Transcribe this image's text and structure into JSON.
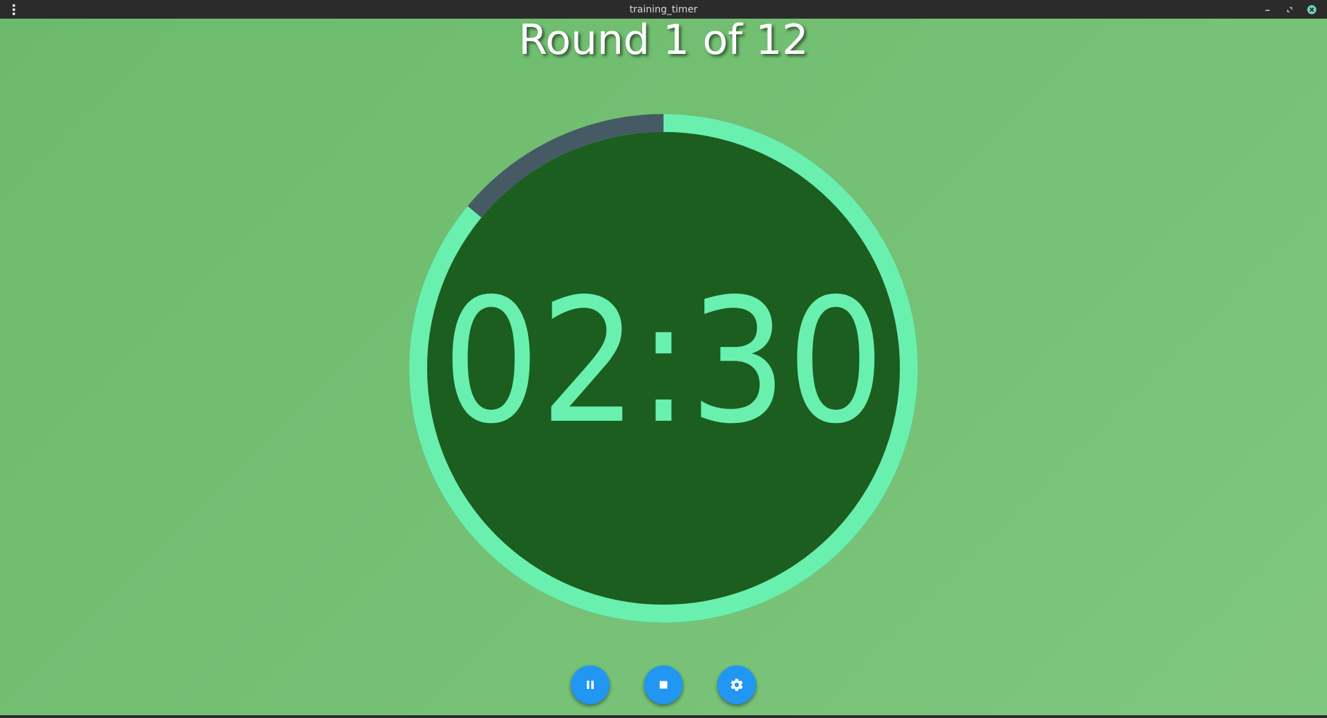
{
  "window": {
    "title": "training_timer"
  },
  "header": {
    "round_label": "Round 1 of 12"
  },
  "timer": {
    "display": "02:30",
    "remaining_fraction": 0.86,
    "colors": {
      "progress": "#69f0ae",
      "track": "#455a64",
      "face": "#1b5e20"
    }
  },
  "controls": {
    "pause_icon": "pause-icon",
    "stop_icon": "stop-icon",
    "settings_icon": "gear-icon",
    "accent": "#2196f3"
  }
}
